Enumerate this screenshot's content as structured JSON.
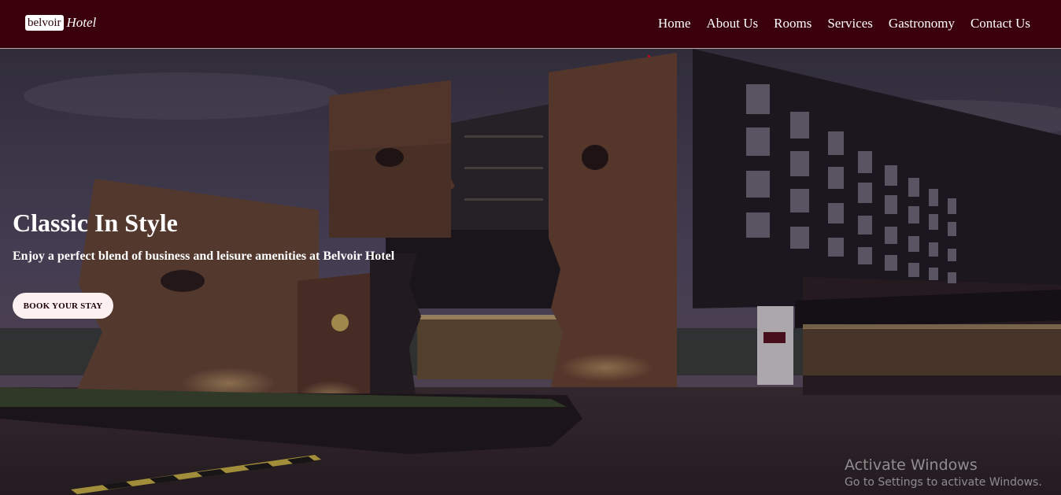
{
  "brand": {
    "box_text": "belvoir",
    "suffix": "Hotel"
  },
  "nav": {
    "items": [
      "Home",
      "About Us",
      "Rooms",
      "Services",
      "Gastronomy",
      "Contact Us"
    ]
  },
  "hero": {
    "title": "Classic In Style",
    "subtitle": "Enjoy a perfect blend of business and leisure amenities at Belvoir Hotel",
    "cta_label": "BOOK YOUR STAY"
  },
  "watermark": {
    "title": "Activate Windows",
    "subtitle": "Go to Settings to activate Windows."
  },
  "colors": {
    "navbar_bg": "#3a000c",
    "button_bg": "#fdf0f1",
    "text": "#ffffff"
  }
}
